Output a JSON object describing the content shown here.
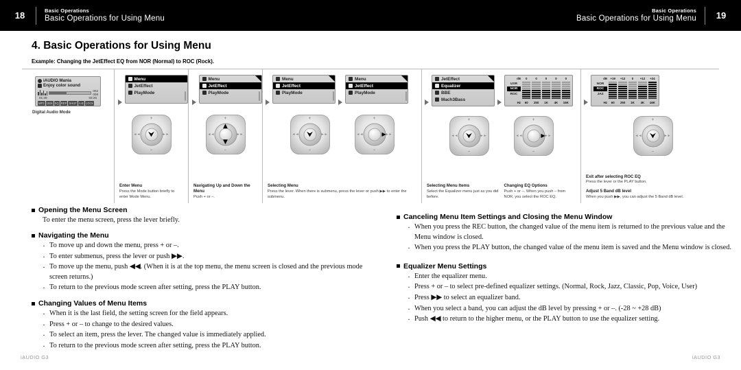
{
  "header": {
    "left": {
      "page": "18",
      "sub": "Basic Operations",
      "main": "Basic Operations for Using Menu"
    },
    "right": {
      "page": "19",
      "sub": "Basic Operations",
      "main": "Basic Operations for Using Menu"
    }
  },
  "section": {
    "title": "4. Basic Operations for Using Menu",
    "example": "Example: Changing the JetEffect EQ from NOR (Normal) to ROC (Rock)."
  },
  "flow": {
    "screen1": {
      "title": "iAUDIO Mania",
      "subtitle": "Enjoy color sound",
      "time_elapsed": "01:49",
      "time_total": "03:25",
      "counter_top": "002",
      "counter_bottom": "008",
      "status": [
        "MP3",
        "192k",
        "EQ",
        "REP",
        "SHUF",
        "A-B",
        "LOCK"
      ],
      "caption": "Digital Audio Mode"
    },
    "menu1": {
      "title": "Menu",
      "items": [
        "JetEffect",
        "PlayMode"
      ],
      "selected": -1
    },
    "menu2": {
      "title": "Menu",
      "items": [
        "JetEffect",
        "PlayMode"
      ],
      "selected": 0
    },
    "menu3": {
      "title": "Menu",
      "items": [
        "JetEffect",
        "PlayMode"
      ],
      "selected": 0
    },
    "menu4": {
      "title": "Menu",
      "items": [
        "JetEffect",
        "PlayMode"
      ],
      "selected": 0
    },
    "submenu": {
      "items": [
        "JetEffect",
        "Equalizer",
        "BBE",
        "Mach3Bass"
      ],
      "selected": 1
    },
    "eq_nor": {
      "db_label": "dB",
      "hz_label": "Hz",
      "presets": [
        "USR",
        "NOR",
        "ROC"
      ],
      "selected_preset": "NOR",
      "values": [
        "0",
        "0",
        "0",
        "0",
        "0"
      ],
      "bands": [
        "60",
        "250",
        "1K",
        "4K",
        "16K"
      ]
    },
    "eq_roc": {
      "db_label": "dB",
      "hz_label": "Hz",
      "presets": [
        "NOR",
        "ROC",
        "JAZ"
      ],
      "selected_preset": "ROC",
      "values": [
        "+19",
        "+12",
        "0",
        "+12",
        "+24"
      ],
      "bands": [
        "60",
        "250",
        "1K",
        "4K",
        "16K"
      ]
    },
    "pad_labels": {
      "up": "+",
      "down": "–",
      "left": "◄◄",
      "right": "►►"
    },
    "captions": [
      {
        "title": "Enter Menu",
        "desc": "Press the Mode button briefly to enter Mode Menu."
      },
      {
        "title": "Navigating Up and Down the Menu",
        "desc": "Push + or –."
      },
      {
        "title": "Selecting Menu",
        "desc": "Press the lever. When there is submenu, press the lever or push ▶▶ to enter the submenu."
      },
      {
        "title": "Selecting Menu Items",
        "desc": "Select the Equalizer menu just as you did before."
      },
      {
        "title": "Changing EQ Options",
        "desc": "Push + or –. When you push – from NOR, you select the ROC EQ."
      },
      {
        "title": "Exit after selecting ROC EQ",
        "desc": "Press the lever or the PLAY button."
      },
      {
        "title": "Adjust 5 Band dB level",
        "desc": "When you push ▶▶, you can adjust the 5 Band dB level."
      }
    ]
  },
  "left_column": [
    {
      "heading": "Opening the Menu Screen",
      "paragraph": "To enter the menu screen, press the lever briefly.",
      "bullets": []
    },
    {
      "heading": "Navigating the Menu",
      "paragraph": "",
      "bullets": [
        "To move up and down the menu, press + or –.",
        "To enter submenus, press the lever or push ▶▶.",
        "To move up the menu, push ◀◀. (When it is at the top menu, the menu screen is closed and the previous mode screen returns.)",
        "To return to the previous mode screen after setting, press the PLAY button."
      ]
    },
    {
      "heading": "Changing Values of Menu Items",
      "paragraph": "",
      "bullets": [
        "When it is the last field, the setting screen for the field appears.",
        "Press + or – to change to the desired values.",
        "To select an item, press the lever. The changed value is immediately applied.",
        "To return to the previous mode screen after setting, press the PLAY button."
      ]
    }
  ],
  "right_column": [
    {
      "heading": "Canceling Menu Item Settings and Closing the Menu Window",
      "paragraph": "",
      "bullets": [
        "When you press the REC button, the changed value of the menu item is returned to the previous value and the Menu window is closed.",
        "When you press the PLAY button, the changed value of the menu item is saved and the Menu window is closed."
      ]
    },
    {
      "heading": "Equalizer Menu Settings",
      "paragraph": "",
      "bullets": [
        "Enter the equalizer menu.",
        "Press + or – to select pre-defined equalizer settings. (Normal, Rock, Jazz, Classic, Pop, Voice, User)",
        "Press ▶▶ to select an equalizer band.",
        "When you select a band, you can adjust the dB level by pressing + or –. (-28 ~ +28 dB)",
        "Push ◀◀ to return to the higher menu, or the PLAY button to use the equalizer setting."
      ]
    }
  ],
  "footer": {
    "left": "iAUDIO G3",
    "right": "iAUDIO G3"
  }
}
